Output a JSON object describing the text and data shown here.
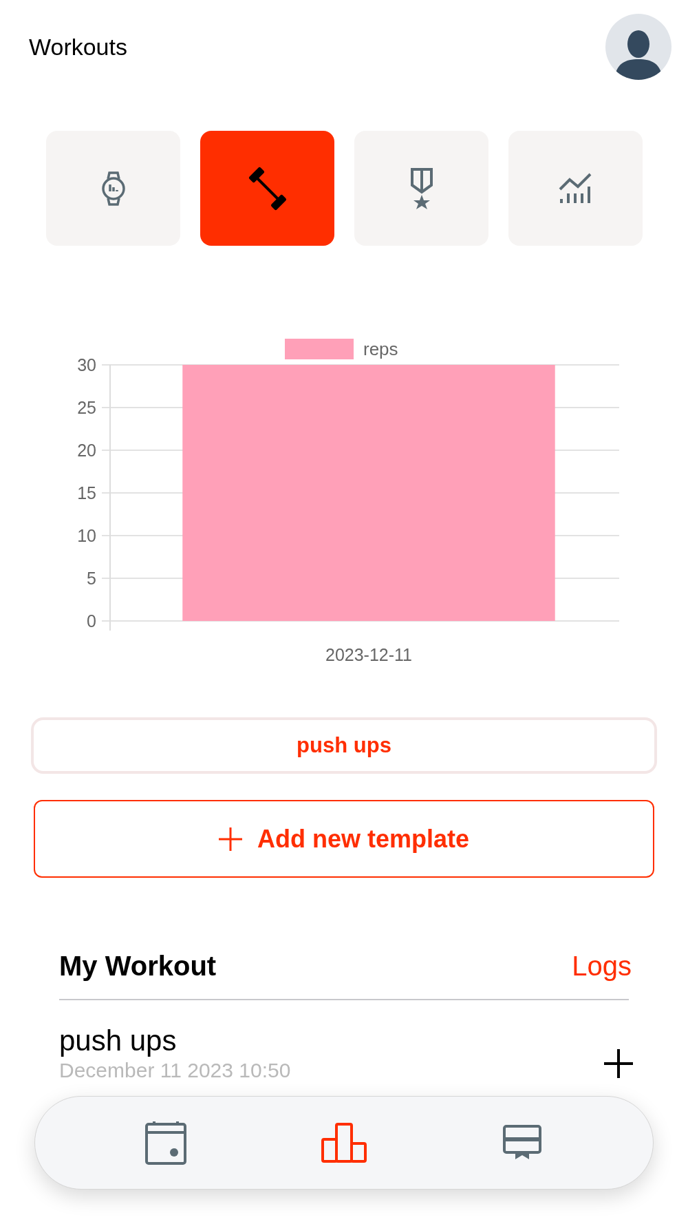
{
  "header": {
    "title": "Workouts"
  },
  "tabs": [
    {
      "kind": "watch",
      "selected": false
    },
    {
      "kind": "dumbbell",
      "selected": true
    },
    {
      "kind": "medal",
      "selected": false
    },
    {
      "kind": "trend",
      "selected": false
    }
  ],
  "chart_data": {
    "type": "bar",
    "categories": [
      "2023-12-11"
    ],
    "series": [
      {
        "name": "reps",
        "color": "#ffa0b8",
        "values": [
          30
        ]
      }
    ],
    "ylim": [
      0,
      30
    ],
    "yticks": [
      0,
      5,
      10,
      15,
      20,
      25,
      30
    ],
    "grid": true
  },
  "exercise_button": "push ups",
  "add_button": "Add new template",
  "section": {
    "title": "My Workout",
    "link": "Logs"
  },
  "workouts": [
    {
      "name": "push ups",
      "date": "December 11 2023 10:50"
    }
  ],
  "bottom_nav": [
    {
      "kind": "calendar",
      "selected": false
    },
    {
      "kind": "chart",
      "selected": true
    },
    {
      "kind": "card",
      "selected": false
    }
  ]
}
